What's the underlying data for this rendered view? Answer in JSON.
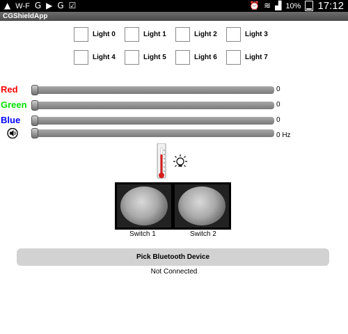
{
  "status_bar": {
    "left_icons": [
      "warning-icon",
      "wifi-icon",
      "app-g-icon",
      "media-icon",
      "app-g2-icon",
      "notification-check-icon"
    ],
    "wifi_text": "W-F",
    "battery_percent": "10%",
    "clock": "17:12"
  },
  "app": {
    "title": "CGShieldApp"
  },
  "lights": [
    {
      "label": "Light 0",
      "checked": false
    },
    {
      "label": "Light 1",
      "checked": false
    },
    {
      "label": "Light 2",
      "checked": false
    },
    {
      "label": "Light 3",
      "checked": false
    },
    {
      "label": "Light 4",
      "checked": false
    },
    {
      "label": "Light 5",
      "checked": false
    },
    {
      "label": "Light 6",
      "checked": false
    },
    {
      "label": "Light 7",
      "checked": false
    }
  ],
  "sliders": {
    "red": {
      "label": "Red",
      "value": "0",
      "color": "#ff0000"
    },
    "green": {
      "label": "Green",
      "value": "0",
      "color": "#00e000"
    },
    "blue": {
      "label": "Blue",
      "value": "0",
      "color": "#0000ff"
    },
    "sound": {
      "icon": "speaker-icon",
      "value": "0 Hz"
    }
  },
  "sensors": {
    "temperature_icon": "thermometer-icon",
    "light_icon": "light-bulb-icon"
  },
  "switches": [
    {
      "label": "Switch 1"
    },
    {
      "label": "Switch 2"
    }
  ],
  "bluetooth": {
    "button_label": "Pick Bluetooth Device",
    "status": "Not Connected"
  }
}
